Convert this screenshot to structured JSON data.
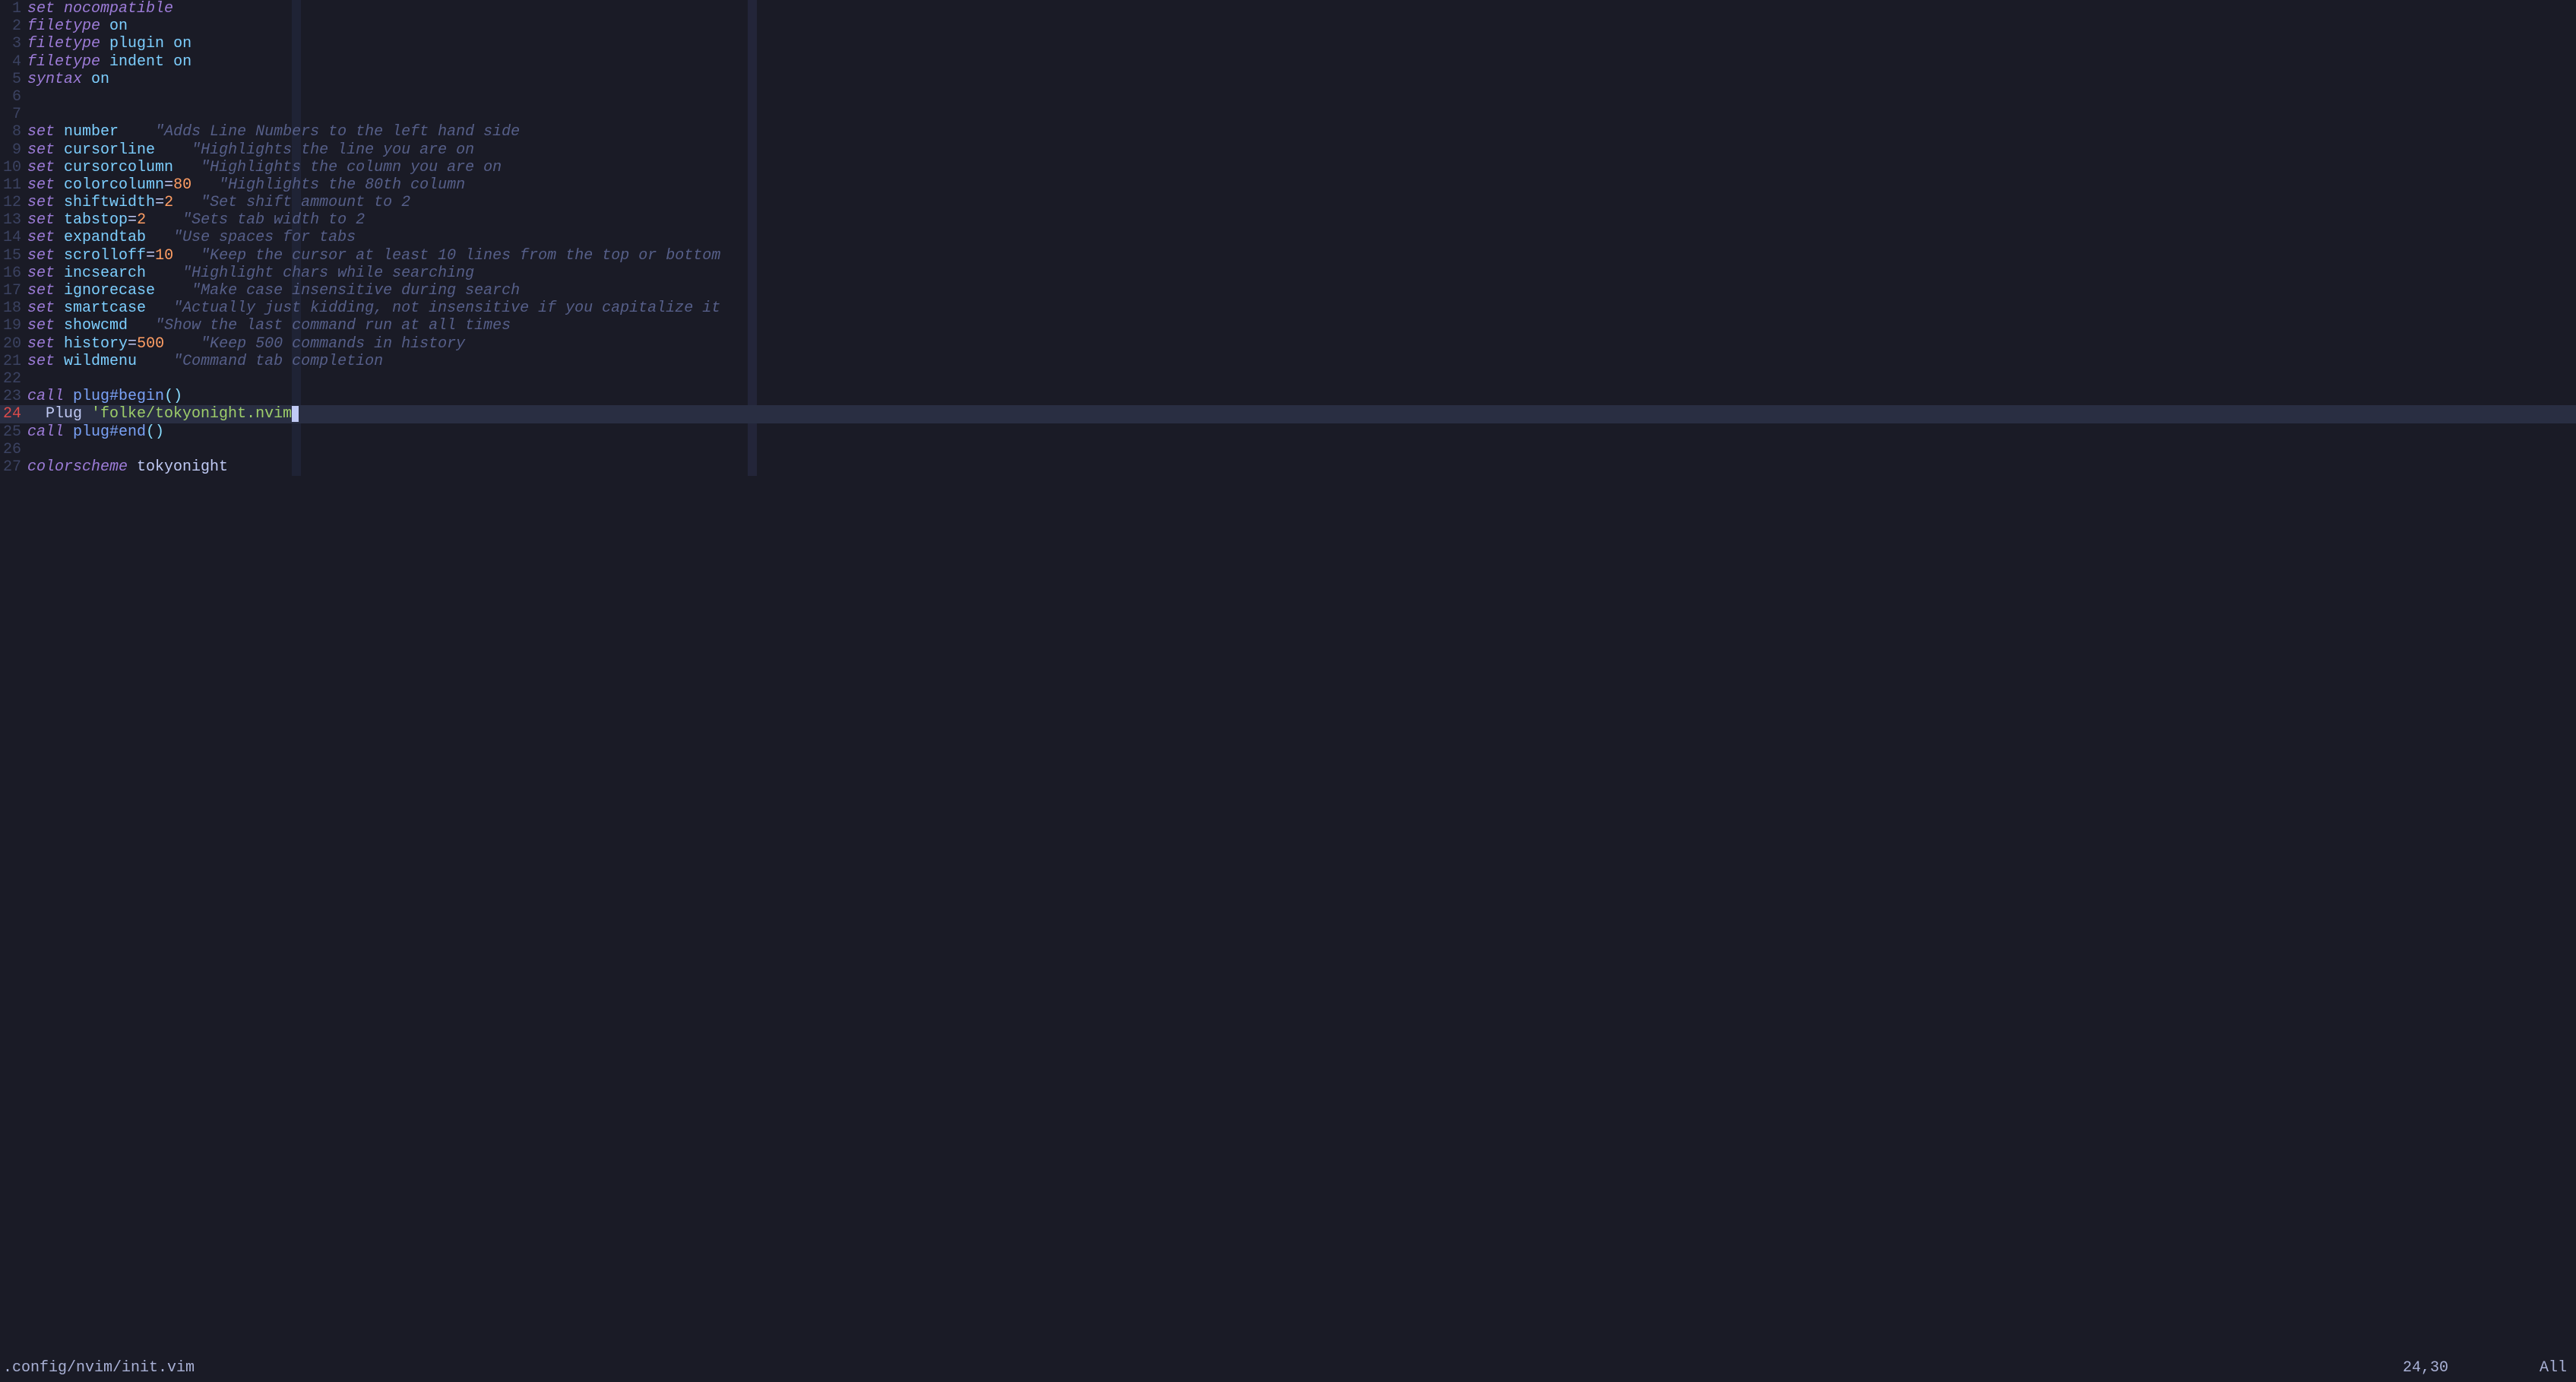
{
  "cursor": {
    "line": 24,
    "col_ch": 29
  },
  "colorcolumn": 80,
  "lines": [
    {
      "n": 1,
      "tokens": [
        [
          "keyword",
          "set"
        ],
        [
          "plain",
          " "
        ],
        [
          "keyword",
          "nocompatible"
        ]
      ]
    },
    {
      "n": 2,
      "tokens": [
        [
          "keyword",
          "filetype"
        ],
        [
          "plain",
          " "
        ],
        [
          "option",
          "on"
        ]
      ]
    },
    {
      "n": 3,
      "tokens": [
        [
          "keyword",
          "filetype"
        ],
        [
          "plain",
          " "
        ],
        [
          "option",
          "plugin"
        ],
        [
          "plain",
          " "
        ],
        [
          "option",
          "on"
        ]
      ]
    },
    {
      "n": 4,
      "tokens": [
        [
          "keyword",
          "filetype"
        ],
        [
          "plain",
          " "
        ],
        [
          "option",
          "indent"
        ],
        [
          "plain",
          " "
        ],
        [
          "option",
          "on"
        ]
      ]
    },
    {
      "n": 5,
      "tokens": [
        [
          "keyword",
          "syntax"
        ],
        [
          "plain",
          " "
        ],
        [
          "option",
          "on"
        ]
      ]
    },
    {
      "n": 6,
      "tokens": []
    },
    {
      "n": 7,
      "tokens": []
    },
    {
      "n": 8,
      "tokens": [
        [
          "keyword",
          "set"
        ],
        [
          "plain",
          " "
        ],
        [
          "option",
          "number"
        ],
        [
          "plain",
          "    "
        ],
        [
          "comment",
          "\"Adds Line Numbers to the left hand side"
        ]
      ]
    },
    {
      "n": 9,
      "tokens": [
        [
          "keyword",
          "set"
        ],
        [
          "plain",
          " "
        ],
        [
          "option",
          "cursorline"
        ],
        [
          "plain",
          "    "
        ],
        [
          "comment",
          "\"Highlights the line you are on"
        ]
      ]
    },
    {
      "n": 10,
      "tokens": [
        [
          "keyword",
          "set"
        ],
        [
          "plain",
          " "
        ],
        [
          "option",
          "cursorcolumn"
        ],
        [
          "plain",
          "   "
        ],
        [
          "comment",
          "\"Highlights the column you are on"
        ]
      ]
    },
    {
      "n": 11,
      "tokens": [
        [
          "keyword",
          "set"
        ],
        [
          "plain",
          " "
        ],
        [
          "option",
          "colorcolumn"
        ],
        [
          "plain",
          "="
        ],
        [
          "value",
          "80"
        ],
        [
          "plain",
          "   "
        ],
        [
          "comment",
          "\"Highlights the 80th column"
        ]
      ]
    },
    {
      "n": 12,
      "tokens": [
        [
          "keyword",
          "set"
        ],
        [
          "plain",
          " "
        ],
        [
          "option",
          "shiftwidth"
        ],
        [
          "plain",
          "="
        ],
        [
          "value",
          "2"
        ],
        [
          "plain",
          "   "
        ],
        [
          "comment",
          "\"Set shift ammount to 2"
        ]
      ]
    },
    {
      "n": 13,
      "tokens": [
        [
          "keyword",
          "set"
        ],
        [
          "plain",
          " "
        ],
        [
          "option",
          "tabstop"
        ],
        [
          "plain",
          "="
        ],
        [
          "value",
          "2"
        ],
        [
          "plain",
          "    "
        ],
        [
          "comment",
          "\"Sets tab width to 2"
        ]
      ]
    },
    {
      "n": 14,
      "tokens": [
        [
          "keyword",
          "set"
        ],
        [
          "plain",
          " "
        ],
        [
          "option",
          "expandtab"
        ],
        [
          "plain",
          "   "
        ],
        [
          "comment",
          "\"Use spaces for tabs"
        ]
      ]
    },
    {
      "n": 15,
      "tokens": [
        [
          "keyword",
          "set"
        ],
        [
          "plain",
          " "
        ],
        [
          "option",
          "scrolloff"
        ],
        [
          "plain",
          "="
        ],
        [
          "value",
          "10"
        ],
        [
          "plain",
          "   "
        ],
        [
          "comment",
          "\"Keep the cursor at least 10 lines from the top or bottom"
        ]
      ]
    },
    {
      "n": 16,
      "tokens": [
        [
          "keyword",
          "set"
        ],
        [
          "plain",
          " "
        ],
        [
          "option",
          "incsearch"
        ],
        [
          "plain",
          "    "
        ],
        [
          "comment",
          "\"Highlight chars while searching"
        ]
      ]
    },
    {
      "n": 17,
      "tokens": [
        [
          "keyword",
          "set"
        ],
        [
          "plain",
          " "
        ],
        [
          "option",
          "ignorecase"
        ],
        [
          "plain",
          "    "
        ],
        [
          "comment",
          "\"Make case insensitive during search"
        ]
      ]
    },
    {
      "n": 18,
      "tokens": [
        [
          "keyword",
          "set"
        ],
        [
          "plain",
          " "
        ],
        [
          "option",
          "smartcase"
        ],
        [
          "plain",
          "   "
        ],
        [
          "comment",
          "\"Actually just kidding, not insensitive if you capitalize it"
        ]
      ]
    },
    {
      "n": 19,
      "tokens": [
        [
          "keyword",
          "set"
        ],
        [
          "plain",
          " "
        ],
        [
          "option",
          "showcmd"
        ],
        [
          "plain",
          "   "
        ],
        [
          "comment",
          "\"Show the last command run at all times"
        ]
      ]
    },
    {
      "n": 20,
      "tokens": [
        [
          "keyword",
          "set"
        ],
        [
          "plain",
          " "
        ],
        [
          "option",
          "history"
        ],
        [
          "plain",
          "="
        ],
        [
          "value",
          "500"
        ],
        [
          "plain",
          "    "
        ],
        [
          "comment",
          "\"Keep 500 commands in history"
        ]
      ]
    },
    {
      "n": 21,
      "tokens": [
        [
          "keyword",
          "set"
        ],
        [
          "plain",
          " "
        ],
        [
          "option",
          "wildmenu"
        ],
        [
          "plain",
          "    "
        ],
        [
          "comment",
          "\"Command tab completion"
        ]
      ]
    },
    {
      "n": 22,
      "tokens": []
    },
    {
      "n": 23,
      "tokens": [
        [
          "keyword",
          "call"
        ],
        [
          "plain",
          " "
        ],
        [
          "func",
          "plug#begin"
        ],
        [
          "punct",
          "()"
        ]
      ]
    },
    {
      "n": 24,
      "tokens": [
        [
          "plain",
          "  "
        ],
        [
          "plain",
          "Plug "
        ],
        [
          "string",
          "'folke/tokyonight.nvim'"
        ]
      ],
      "active": true
    },
    {
      "n": 25,
      "tokens": [
        [
          "keyword",
          "call"
        ],
        [
          "plain",
          " "
        ],
        [
          "func",
          "plug#end"
        ],
        [
          "punct",
          "()"
        ]
      ]
    },
    {
      "n": 26,
      "tokens": []
    },
    {
      "n": 27,
      "tokens": [
        [
          "keyword",
          "colorscheme"
        ],
        [
          "plain",
          " tokyonight"
        ]
      ]
    }
  ],
  "status": {
    "file": ".config/nvim/init.vim",
    "position": "24,30",
    "scroll": "All"
  }
}
